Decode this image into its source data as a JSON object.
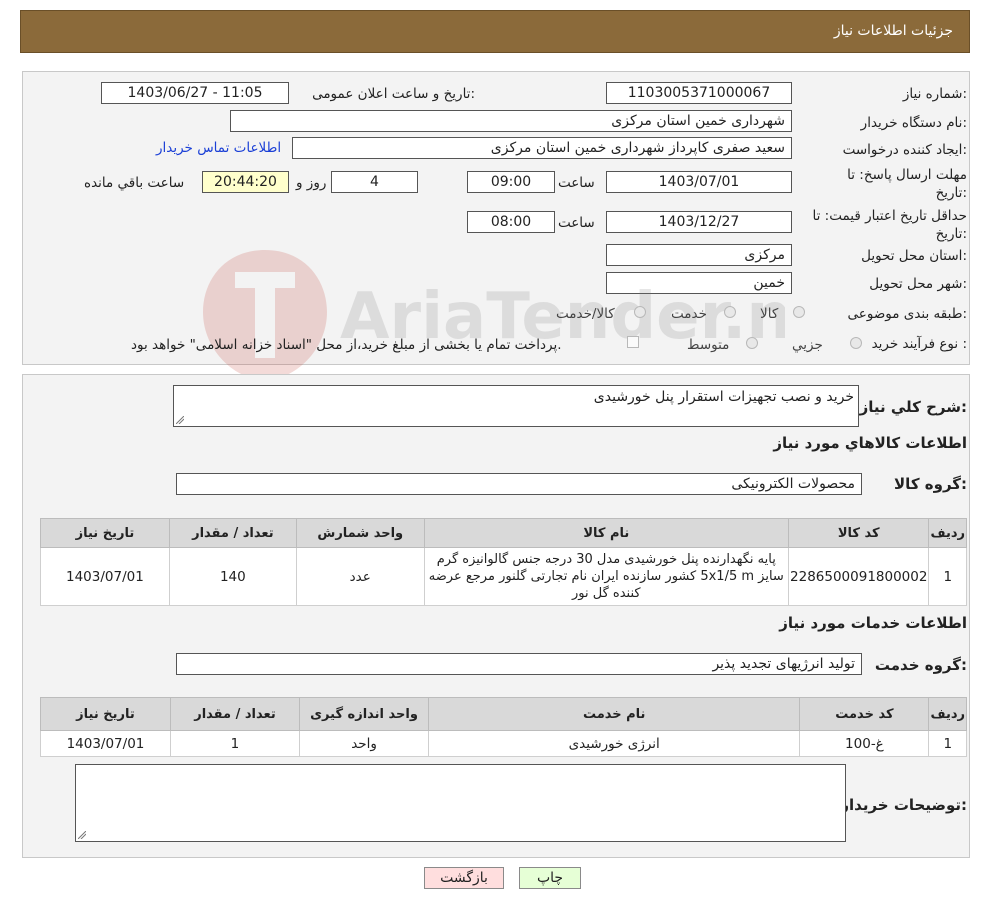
{
  "header": {
    "title": "جزئیات اطلاعات نیاز"
  },
  "form": {
    "need_number_label": "شماره نیاز:",
    "need_number": "1103005371000067",
    "announce_label": "تاریخ و ساعت اعلان عمومی:",
    "announce_value": "1403/06/27 - 11:05",
    "buyer_org_label": "نام دستگاه خریدار:",
    "buyer_org": "شهرداری خمین استان مرکزی",
    "creator_label": "ایجاد کننده درخواست:",
    "creator": "سعید صفری کاپرداز شهرداری خمین استان مرکزی",
    "contact_link": "اطلاعات تماس خریدار",
    "deadline_label_1": "مهلت ارسال پاسخ: تا",
    "deadline_label_2": "تاریخ:",
    "deadline_date": "1403/07/01",
    "time_label": "ساعت",
    "deadline_time": "09:00",
    "days_value": "4",
    "days_label": "روز و",
    "remaining_time": "20:44:20",
    "remaining_label": "ساعت باقي مانده",
    "validity_label_1": "حداقل تاریخ اعتبار قیمت: تا",
    "validity_label_2": "تاریخ:",
    "validity_date": "1403/12/27",
    "validity_time": "08:00",
    "province_label": "استان محل تحویل:",
    "province": "مرکزی",
    "city_label": "شهر محل تحویل:",
    "city": "خمین",
    "category_label": "طبقه بندی موضوعی:",
    "category_options": [
      "کالا",
      "خدمت",
      "کالا/خدمت"
    ],
    "process_label": "نوع فرآیند خرید :",
    "process_options": [
      "جزيي",
      "متوسط"
    ],
    "payment_note": "پرداخت تمام یا بخشی از مبلغ خرید،از محل \"اسناد خزانه اسلامی\" خواهد بود."
  },
  "description": {
    "label": "شرح کلي نياز:",
    "value": "خرید و نصب تجهیزات استقرار پنل خورشیدی"
  },
  "goods": {
    "section_title": "اطلاعات کالاهاي مورد نياز",
    "group_label": "گروه کالا:",
    "group_value": "محصولات الکترونیکی",
    "columns": [
      "رديف",
      "کد کالا",
      "نام کالا",
      "واحد شمارش",
      "تعداد / مقدار",
      "تاریخ نیاز"
    ],
    "rows": [
      {
        "row": "1",
        "code": "2286500091800002",
        "name": "پایه نگهدارنده پنل خورشیدی مدل 30 درجه جنس گالوانیزه گرم سایز 5x1/5 m کشور سازنده ایران نام تجارتی گلنور مرجع عرضه کننده گل نور",
        "unit": "عدد",
        "qty": "140",
        "date": "1403/07/01"
      }
    ]
  },
  "services": {
    "section_title": "اطلاعات خدمات مورد نياز",
    "group_label": "گروه خدمت:",
    "group_value": "تولید انرژیهای تجدید پذیر",
    "columns": [
      "رديف",
      "کد خدمت",
      "نام خدمت",
      "واحد اندازه گیری",
      "تعداد / مقدار",
      "تاریخ نیاز"
    ],
    "rows": [
      {
        "row": "1",
        "code": "غ-100",
        "name": "انرژی خورشیدی",
        "unit": "واحد",
        "qty": "1",
        "date": "1403/07/01"
      }
    ]
  },
  "buyer_notes": {
    "label": "توضیحات خریدار:",
    "value": ""
  },
  "buttons": {
    "print": "چاپ",
    "back": "بازگشت"
  },
  "watermark": {
    "text": "AriaTender.neT"
  },
  "colors": {
    "header_bg": "#8b6a3a",
    "link": "#1a3fd6",
    "yellow_field": "#ffffcc",
    "back_btn": "#ffdede",
    "print_btn": "#e6ffd6"
  }
}
